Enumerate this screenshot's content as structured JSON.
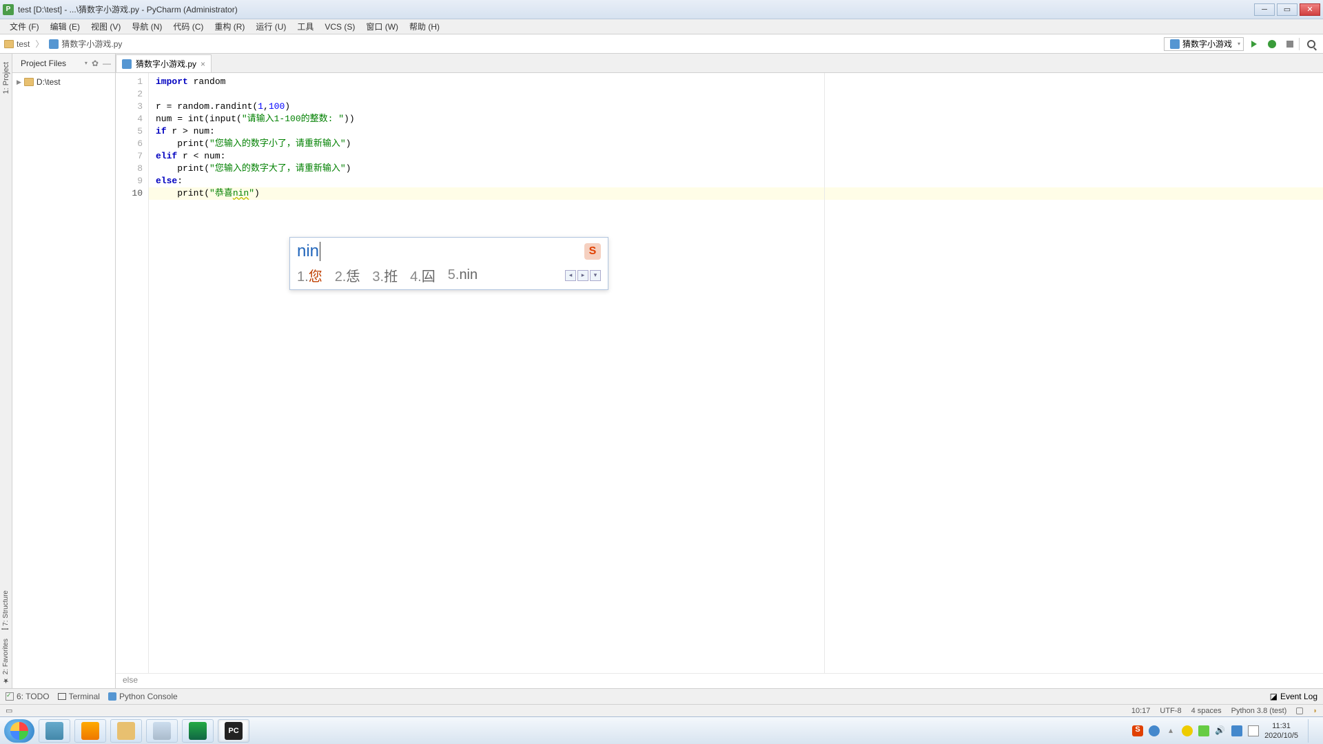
{
  "title": "test [D:\\test] - ...\\猜数字小游戏.py - PyCharm (Administrator)",
  "menu": [
    "文件 (F)",
    "编辑 (E)",
    "视图 (V)",
    "导航 (N)",
    "代码 (C)",
    "重构 (R)",
    "运行 (U)",
    "工具",
    "VCS (S)",
    "窗口 (W)",
    "帮助 (H)"
  ],
  "breadcrumbs": {
    "project": "test",
    "file": "猜数字小游戏.py"
  },
  "run_config": "猜数字小游戏",
  "project_pane": {
    "title": "Project Files",
    "root": "D:\\test"
  },
  "editor_tab": "猜数字小游戏.py",
  "gutter": [
    "1",
    "2",
    "3",
    "4",
    "5",
    "6",
    "7",
    "8",
    "9",
    "10"
  ],
  "code": {
    "l1a": "import",
    "l1b": " random",
    "l3": "r = random.randint(",
    "l3n1": "1",
    "l3m": ",",
    "l3n2": "100",
    "l3e": ")",
    "l4a": "num = int(input(",
    "l4s": "\"请输入1-100的整数: \"",
    "l4e": "))",
    "l5a": "if",
    "l5b": " r > num:",
    "l6a": "    print(",
    "l6s": "\"您输入的数字小了，请重新输入\"",
    "l6e": ")",
    "l7a": "elif",
    "l7b": " r < num:",
    "l8a": "    print(",
    "l8s": "\"您输入的数字大了，请重新输入\"",
    "l8e": ")",
    "l9a": "else",
    "l9b": ":",
    "l10a": "    print(",
    "l10s1": "\"恭喜",
    "l10s2": "nin",
    "l10s3": "\"",
    "l10e": ")"
  },
  "breadcrumb_context": "else",
  "ime": {
    "input": "nin",
    "logo": "S",
    "candidates": [
      {
        "idx": "1.",
        "char": "您"
      },
      {
        "idx": "2.",
        "char": "恁"
      },
      {
        "idx": "3.",
        "char": "拰"
      },
      {
        "idx": "4.",
        "char": "囜"
      },
      {
        "idx": "5.",
        "char": "nin"
      }
    ]
  },
  "bottom_tools": {
    "todo": "6: TODO",
    "terminal": "Terminal",
    "python_console": "Python Console",
    "event_log": "Event Log"
  },
  "status": {
    "pos": "10:17",
    "encoding": "UTF-8",
    "indent": "4 spaces",
    "interpreter": "Python 3.8 (test)"
  },
  "tray": {
    "time": "11:31",
    "date": "2020/10/5"
  }
}
